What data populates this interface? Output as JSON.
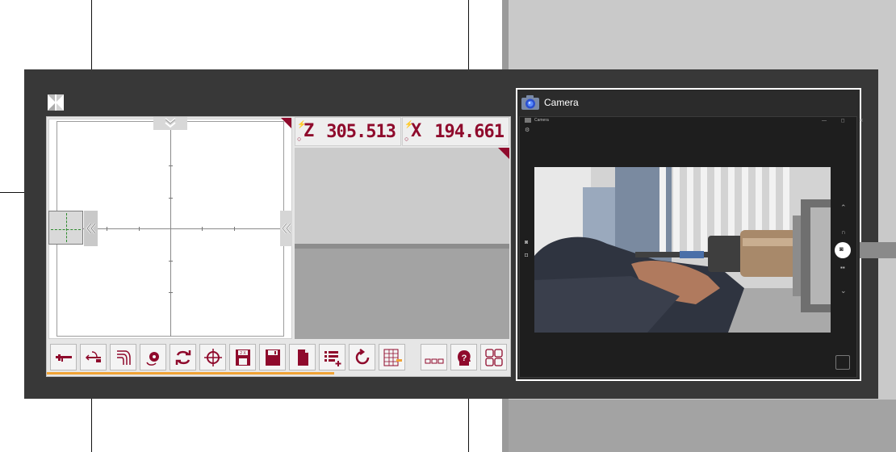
{
  "app": {
    "dro": [
      {
        "axis": "Z",
        "value": "305.513"
      },
      {
        "axis": "X",
        "value": "194.661"
      }
    ],
    "toolbar": [
      {
        "name": "caliper-tool-button",
        "icon": "caliper-icon"
      },
      {
        "name": "measure-tool-button",
        "icon": "measure-arrow-icon"
      },
      {
        "name": "angle-tool-button",
        "icon": "angle-lines-icon"
      },
      {
        "name": "tool-holder-button",
        "icon": "tool-holder-icon"
      },
      {
        "name": "swap-button",
        "icon": "swap-arrows-icon"
      },
      {
        "name": "crosshair-button",
        "icon": "crosshair-icon"
      },
      {
        "name": "save-as-button",
        "icon": "save-as-icon"
      },
      {
        "name": "save-button",
        "icon": "floppy-disk-icon"
      },
      {
        "name": "document-button",
        "icon": "document-icon"
      },
      {
        "name": "list-add-button",
        "icon": "list-add-icon"
      },
      {
        "name": "refresh-button",
        "icon": "refresh-icon"
      },
      {
        "name": "table-button",
        "icon": "table-pencil-icon"
      },
      {
        "name": "more-button",
        "icon": "ellipsis-icon"
      },
      {
        "name": "help-button",
        "icon": "help-head-icon"
      },
      {
        "name": "layout-button",
        "icon": "grid-layout-icon"
      }
    ],
    "progress": 0.62,
    "accent_color": "#8f0a2c",
    "progress_color": "#f0a335"
  },
  "camera": {
    "title": "Camera",
    "inner_title": "Camera"
  }
}
